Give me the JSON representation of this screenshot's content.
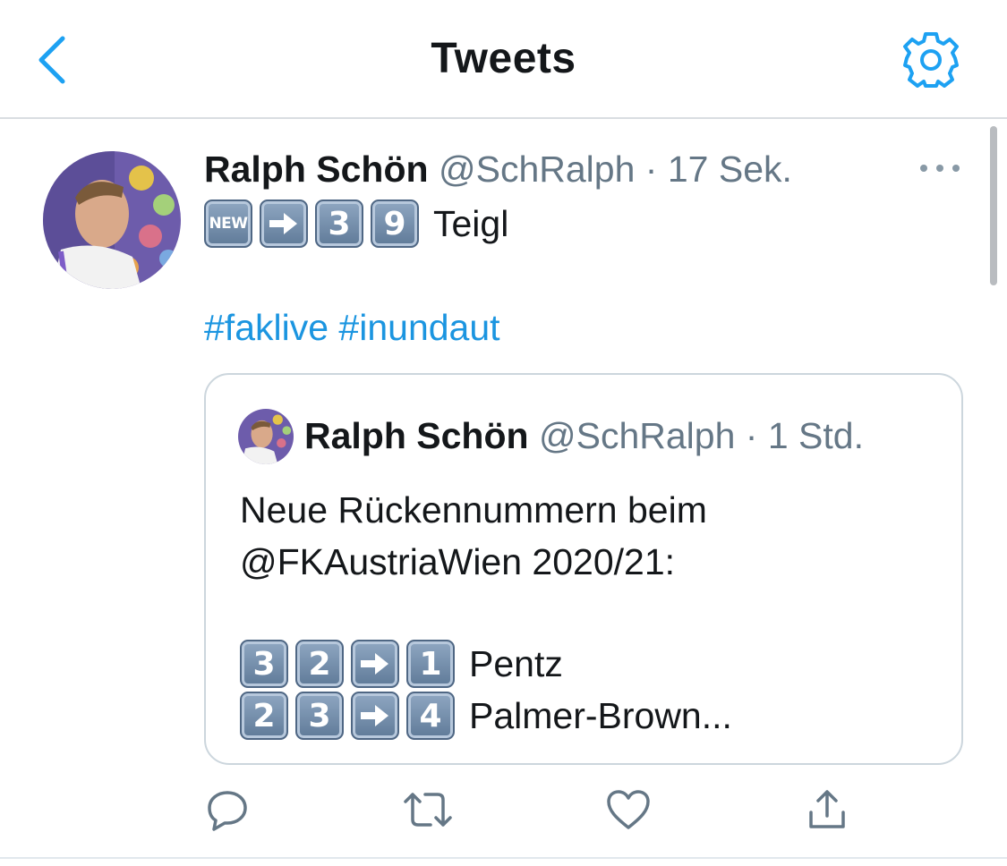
{
  "header": {
    "title": "Tweets",
    "back_icon": "chevron-left-icon",
    "settings_icon": "gear-icon",
    "accent_color": "#1da1f2"
  },
  "tweet": {
    "author_name": "Ralph Schön",
    "handle": "@SchRalph",
    "separator": "·",
    "time": "17 Sek.",
    "keycaps": [
      "NEW",
      "→",
      "3",
      "9"
    ],
    "text": "Teigl",
    "hashtags": [
      "#faklive",
      "#inundaut"
    ],
    "hashtag_color": "#1b95e0"
  },
  "quote": {
    "author_name": "Ralph Schön",
    "handle": "@SchRalph",
    "separator": "·",
    "time": "1 Std.",
    "text_lines": [
      "Neue Rückennummern beim",
      "@FKAustriaWien 2020/21:"
    ],
    "rows": [
      {
        "keycaps": [
          "3",
          "2",
          "→",
          "1"
        ],
        "text": "Pentz"
      },
      {
        "keycaps": [
          "2",
          "3",
          "→",
          "4"
        ],
        "text": "Palmer-Brown..."
      }
    ]
  },
  "actions": [
    "reply-icon",
    "retweet-icon",
    "like-icon",
    "share-icon"
  ]
}
